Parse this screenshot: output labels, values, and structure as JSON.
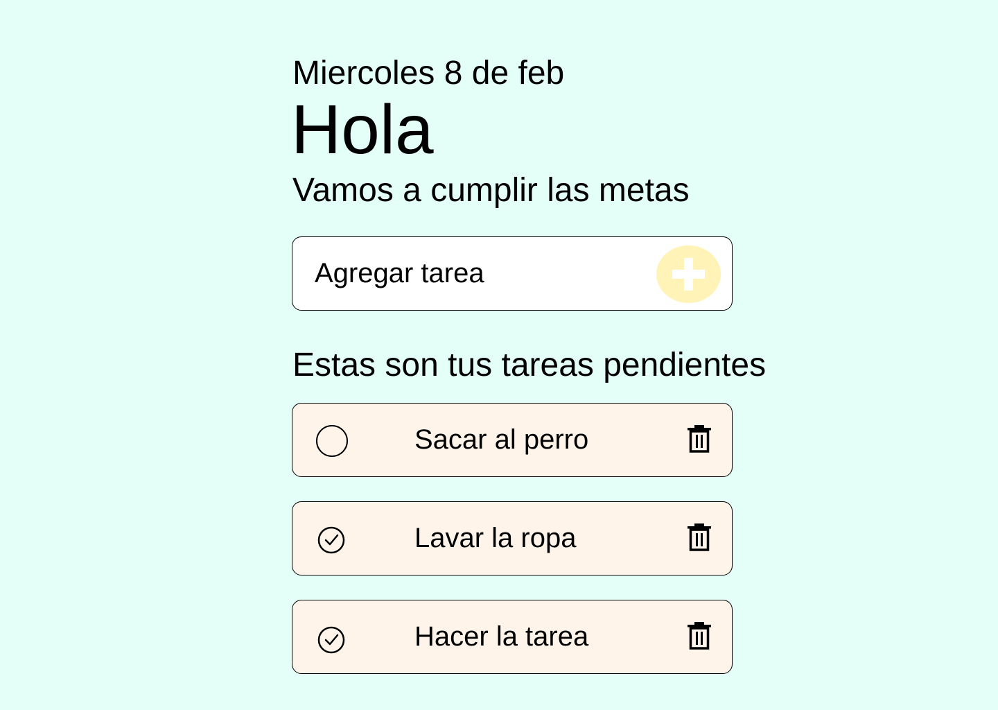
{
  "colors": {
    "background": "#e3fff8",
    "add_box_bg": "#ffffff",
    "task_bg": "#fff4ea",
    "add_button_circle": "#fff3b8",
    "add_button_plus": "#ffffff",
    "border": "#000000"
  },
  "header": {
    "date": "Miercoles 8 de feb",
    "greeting": "Hola",
    "subtitle": "Vamos a cumplir las metas"
  },
  "add_task": {
    "placeholder": "Agregar tarea",
    "value": "",
    "button_icon": "plus-icon"
  },
  "tasks_section": {
    "title": "Estas son tus tareas pendientes"
  },
  "tasks": [
    {
      "label": "Sacar al perro",
      "completed": false,
      "check_icon": "empty-circle-icon",
      "delete_icon": "trash-icon"
    },
    {
      "label": "Lavar la ropa",
      "completed": true,
      "check_icon": "check-circle-icon",
      "delete_icon": "trash-icon"
    },
    {
      "label": "Hacer la tarea",
      "completed": true,
      "check_icon": "check-circle-icon",
      "delete_icon": "trash-icon"
    }
  ]
}
